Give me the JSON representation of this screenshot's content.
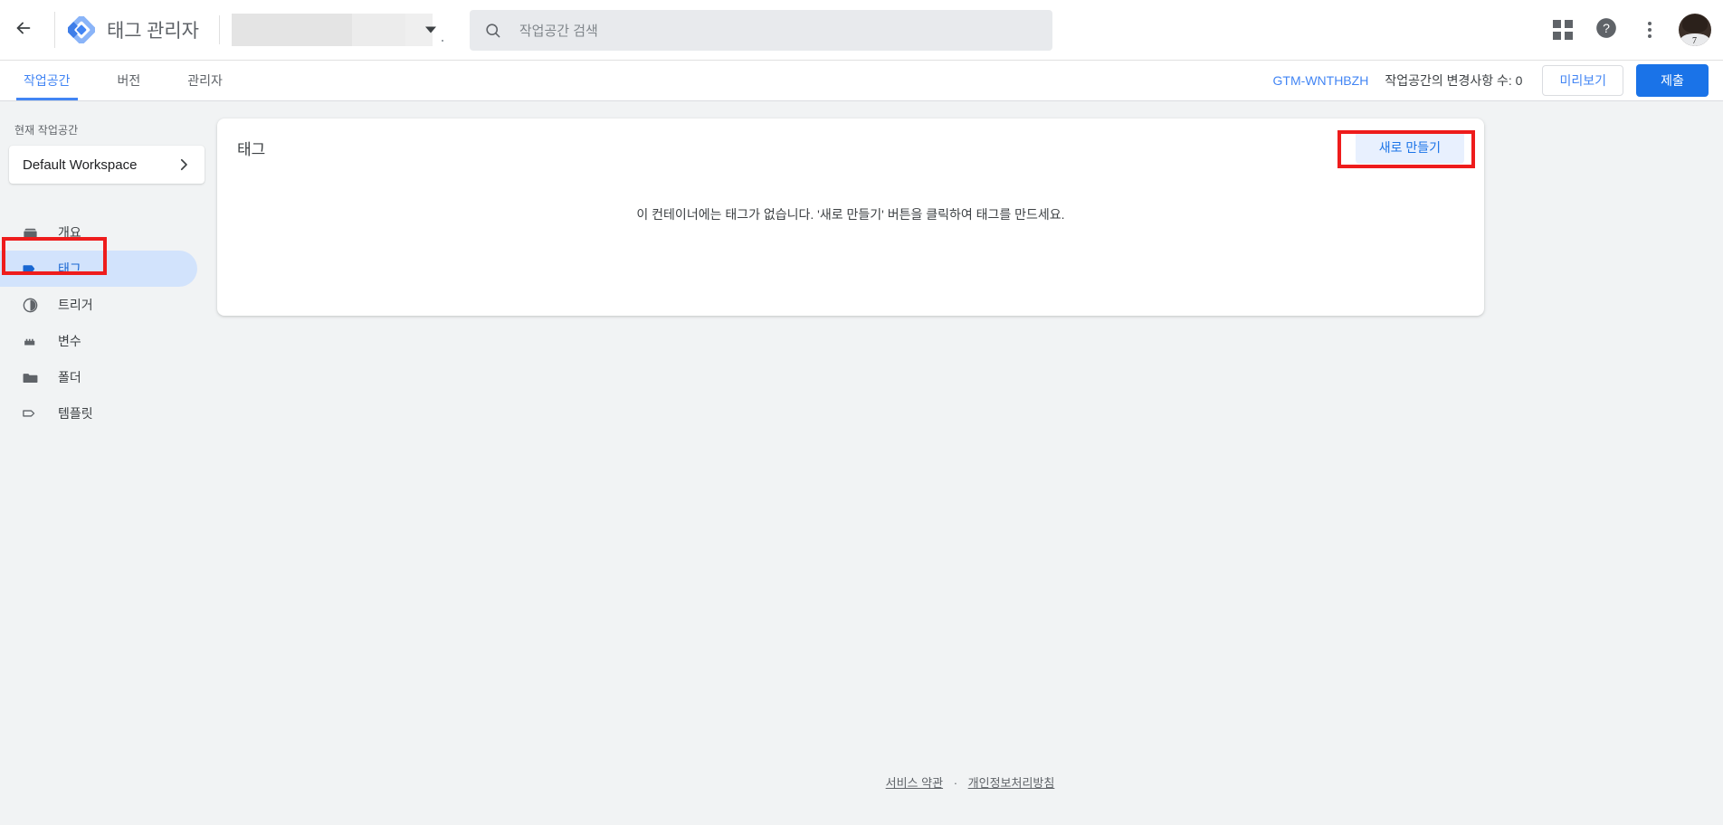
{
  "topbar": {
    "back_icon": "arrow-back-icon",
    "logo_icon": "tag-manager-logo",
    "product_title": "태그 관리자",
    "account_selector": {
      "value": "",
      "caret_icon": "dropdown-caret-icon"
    },
    "search": {
      "icon": "search-icon",
      "placeholder": "작업공간 검색",
      "value": ""
    },
    "actions": {
      "apps_label": "apps-grid-icon",
      "help_label": "help-icon",
      "more_label": "more-vert-icon",
      "avatar_label": "account-avatar"
    }
  },
  "tabbar": {
    "tabs": [
      {
        "label": "작업공간",
        "active": true
      },
      {
        "label": "버전",
        "active": false
      },
      {
        "label": "관리자",
        "active": false
      }
    ],
    "container_id": "GTM-WNTHBZH",
    "changes_count": "작업공간의 변경사항 수: 0",
    "preview_label": "미리보기",
    "submit_label": "제출"
  },
  "sidebar": {
    "workspace_label": "현재 작업공간",
    "workspace_name": "Default Workspace",
    "workspace_chevron_icon": "chevron-right-icon",
    "items": [
      {
        "label": "개요",
        "icon": "overview-icon",
        "active": false
      },
      {
        "label": "태그",
        "icon": "tag-icon",
        "active": true
      },
      {
        "label": "트리거",
        "icon": "trigger-icon",
        "active": false
      },
      {
        "label": "변수",
        "icon": "variable-icon",
        "active": false
      },
      {
        "label": "폴더",
        "icon": "folder-icon",
        "active": false
      },
      {
        "label": "템플릿",
        "icon": "template-icon",
        "active": false
      }
    ]
  },
  "main": {
    "card_title": "태그",
    "new_button_label": "새로 만들기",
    "empty_message": "이 컨테이너에는 태그가 없습니다. '새로 만들기' 버튼을 클릭하여 태그를 만드세요."
  },
  "footer": {
    "terms_label": "서비스 약관",
    "separator": "·",
    "privacy_label": "개인정보처리방침"
  },
  "colors": {
    "accent_blue": "#1a73e8",
    "tab_blue": "#4285f4",
    "active_pill": "#d2e3fc",
    "tonal_button_bg": "#e8f0fe",
    "annotation_red": "#ee1c1c",
    "page_bg": "#f1f3f4"
  }
}
